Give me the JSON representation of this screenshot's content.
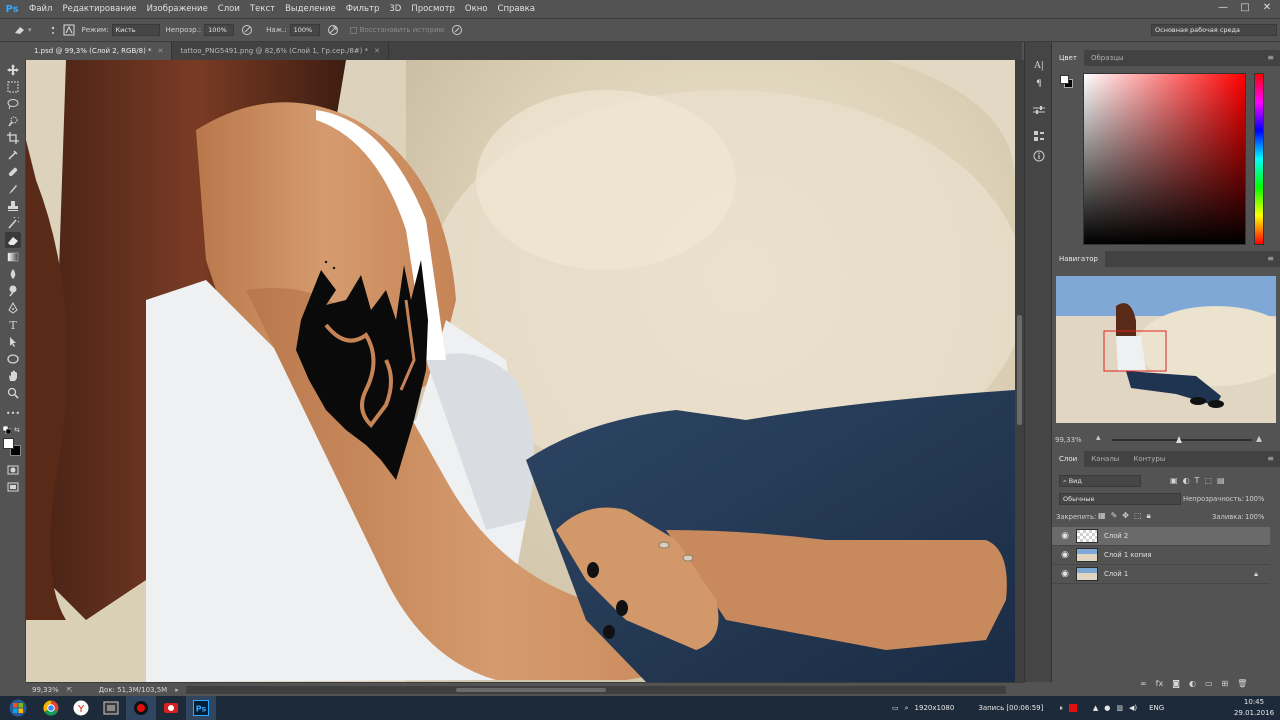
{
  "app": {
    "logo": "Ps"
  },
  "menu": [
    "Файл",
    "Редактирование",
    "Изображение",
    "Слои",
    "Текст",
    "Выделение",
    "Фильтр",
    "3D",
    "Просмотр",
    "Окно",
    "Справка"
  ],
  "window_controls": [
    "—",
    "□",
    "✕"
  ],
  "options": {
    "mode_label": "Режим:",
    "mode_value": "Кисть",
    "opacity_label": "Непрозр.:",
    "opacity_value": "100%",
    "pressure_label": "Наж.:",
    "pressure_value": "100%",
    "history_label": "Восстановить историю",
    "workspace": "Основная рабочая среда"
  },
  "tabs": [
    {
      "label": "1.psd @ 99,3% (Слой 2, RGB/8) *",
      "active": true
    },
    {
      "label": "tattoo_PNG5491.png @ 82,6% (Слой 1, Гр.сер./8#) *",
      "active": false
    }
  ],
  "tools": [
    "move-icon",
    "marquee-icon",
    "lasso-icon",
    "quick-select-icon",
    "crop-icon",
    "eyedropper-icon",
    "healing-icon",
    "brush-icon",
    "stamp-icon",
    "history-brush-icon",
    "eraser-icon",
    "gradient-icon",
    "blur-icon",
    "dodge-icon",
    "pen-icon",
    "type-icon",
    "path-select-icon",
    "shape-icon",
    "hand-icon",
    "zoom-icon",
    "more-icon"
  ],
  "status": {
    "zoom": "99,33%",
    "doc_size": "Док: 51,3M/103,5M"
  },
  "color_panel": {
    "tabs": [
      "Цвет",
      "Образцы"
    ],
    "hue_color": "#ff0000"
  },
  "navigator": {
    "title": "Навигатор",
    "zoom": "99,33%"
  },
  "layers_panel": {
    "tabs": [
      "Слои",
      "Каналы",
      "Контуры"
    ],
    "filter_label": "Вид",
    "blend_mode": "Обычные",
    "opacity_label": "Непрозрачность:",
    "opacity_value": "100%",
    "lock_label": "Закрепить:",
    "fill_label": "Заливка:",
    "fill_value": "100%",
    "layers": [
      {
        "name": "Слой 2",
        "selected": true,
        "locked": false
      },
      {
        "name": "Слой 1 копия",
        "selected": false,
        "locked": false
      },
      {
        "name": "Слой 1",
        "selected": false,
        "locked": true
      }
    ]
  },
  "taskbar": {
    "resolution": "1920x1080",
    "recording": "Запись [00:06:59]",
    "language": "ENG",
    "time": "10:45",
    "date": "29.01.2016"
  }
}
